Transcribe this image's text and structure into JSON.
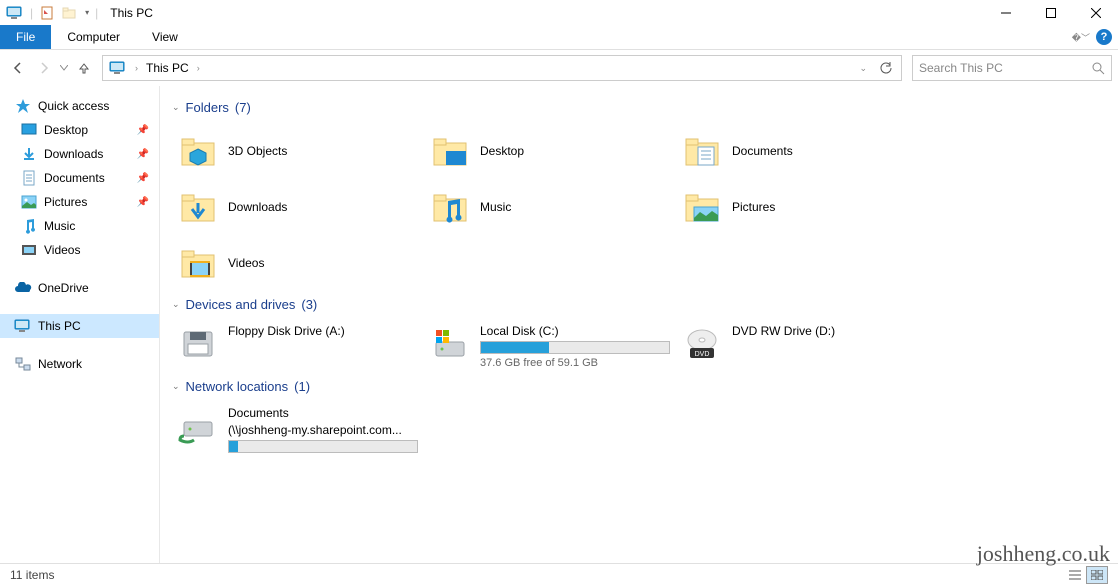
{
  "titlebar": {
    "title": "This PC"
  },
  "ribbon": {
    "file": "File",
    "computer": "Computer",
    "view": "View"
  },
  "navbar": {
    "crumb": "This PC",
    "search_placeholder": "Search This PC"
  },
  "sidebar": {
    "quick_access": "Quick access",
    "desktop": "Desktop",
    "downloads": "Downloads",
    "documents": "Documents",
    "pictures": "Pictures",
    "music": "Music",
    "videos": "Videos",
    "onedrive": "OneDrive",
    "this_pc": "This PC",
    "network": "Network"
  },
  "groups": {
    "folders": {
      "label": "Folders",
      "count": "(7)"
    },
    "drives": {
      "label": "Devices and drives",
      "count": "(3)"
    },
    "netloc": {
      "label": "Network locations",
      "count": "(1)"
    }
  },
  "folders": {
    "objects3d": "3D Objects",
    "desktop": "Desktop",
    "documents": "Documents",
    "downloads": "Downloads",
    "music": "Music",
    "pictures": "Pictures",
    "videos": "Videos"
  },
  "drives": {
    "floppy": {
      "label": "Floppy Disk Drive (A:)"
    },
    "local": {
      "label": "Local Disk (C:)",
      "free_text": "37.6 GB free of 59.1 GB",
      "fill_pct": 36
    },
    "dvd": {
      "label": "DVD RW Drive (D:)"
    }
  },
  "netlocs": {
    "docs": {
      "label": "Documents",
      "sub": "(\\\\joshheng-my.sharepoint.com...",
      "fill_pct": 5
    }
  },
  "statusbar": {
    "items": "11 items"
  },
  "watermark": "joshheng.co.uk"
}
